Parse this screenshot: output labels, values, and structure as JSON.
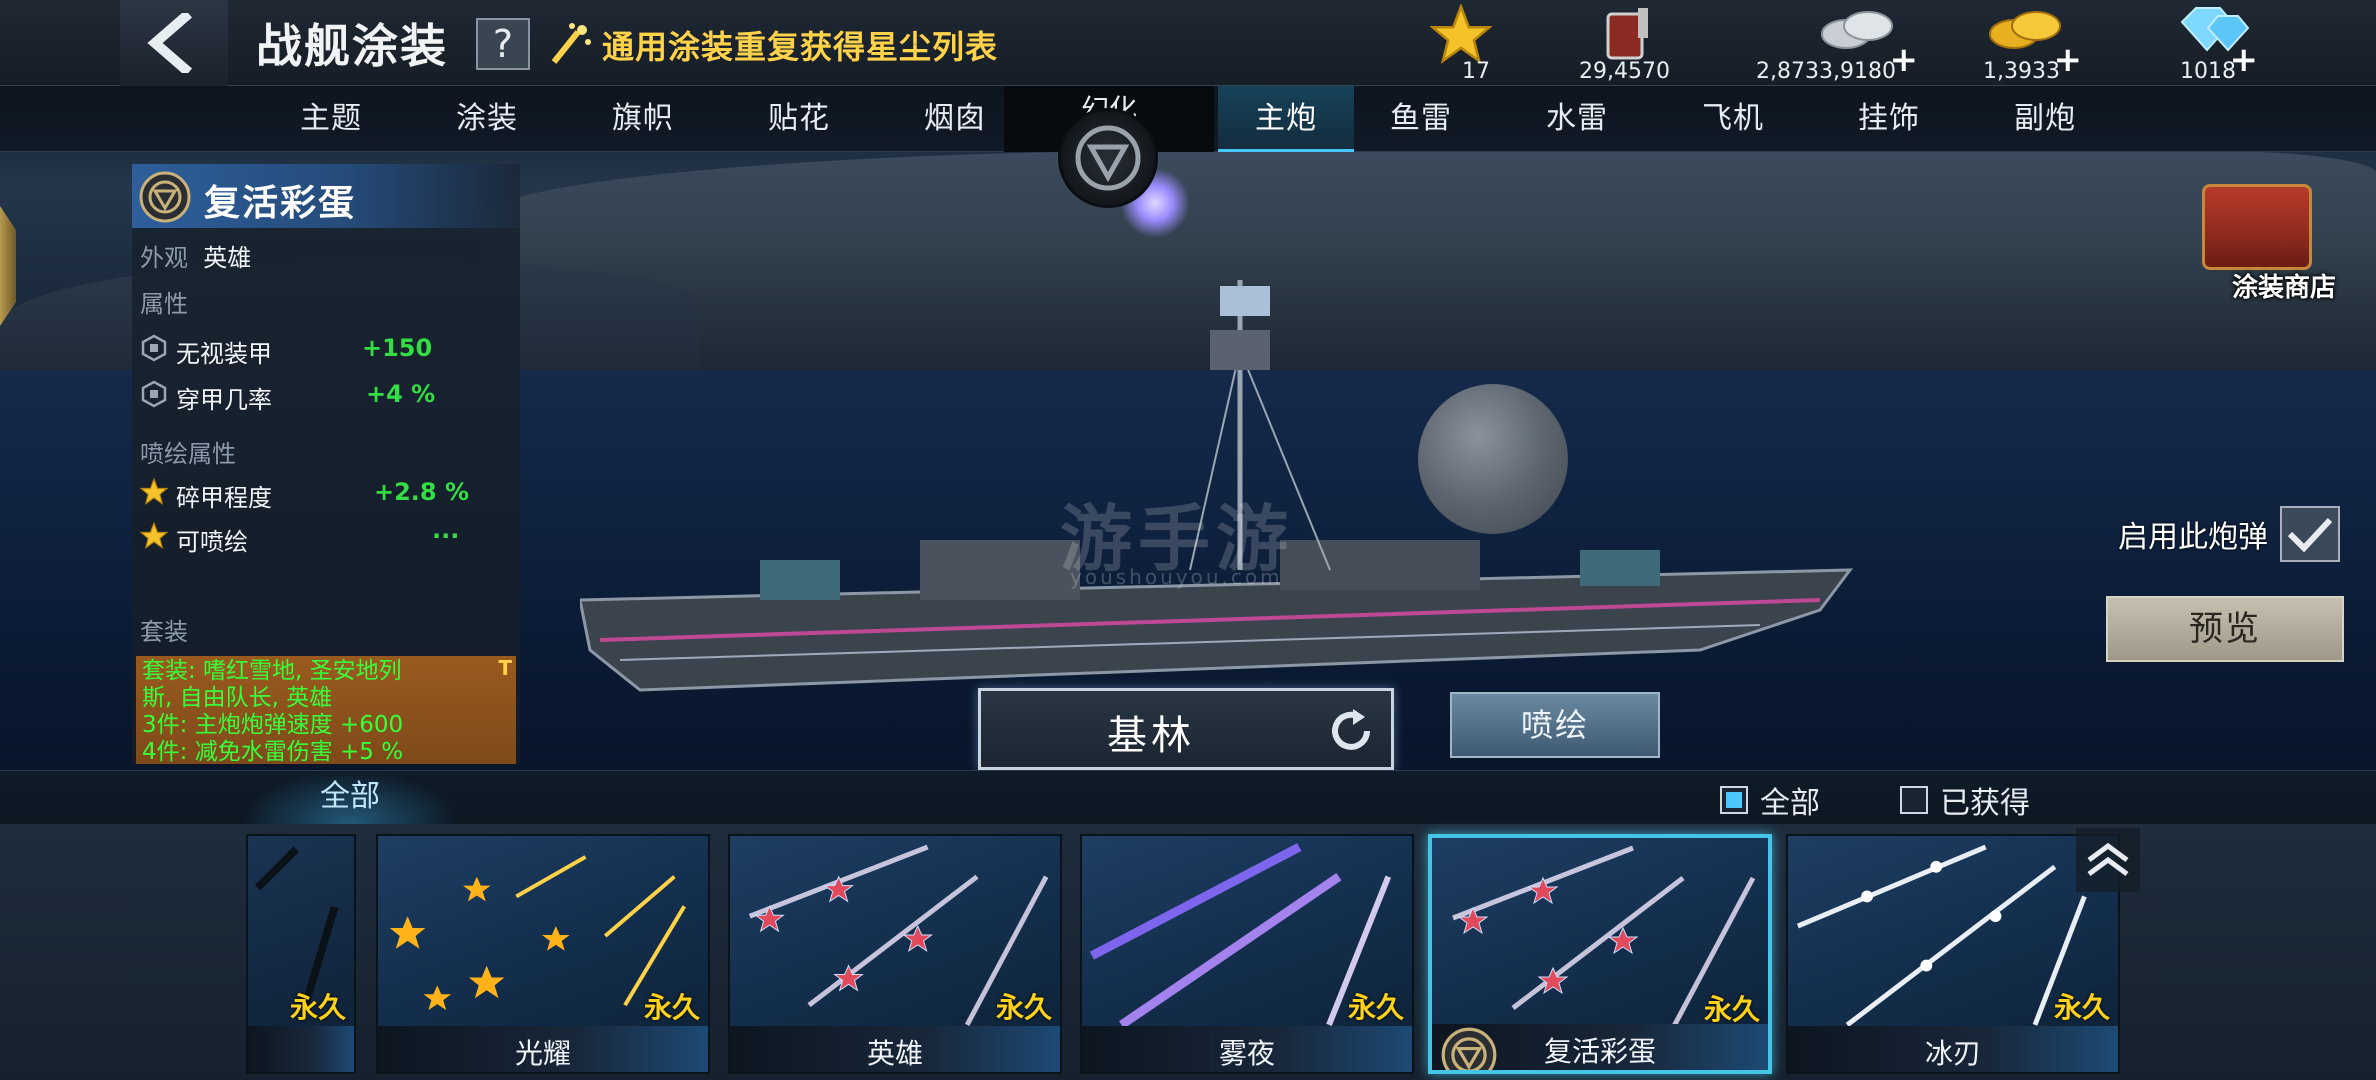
{
  "header": {
    "title": "战舰涂装",
    "help_label": "?",
    "stardust_link": "通用涂装重复获得星尘列表"
  },
  "resources": [
    {
      "icon": "star-icon",
      "value": "17",
      "has_plus": false
    },
    {
      "icon": "paint-bucket-icon",
      "value": "29,4570",
      "has_plus": false
    },
    {
      "icon": "silver-coins-icon",
      "value": "2,8733,9180",
      "has_plus": true
    },
    {
      "icon": "gold-coins-icon",
      "value": "1,3933",
      "has_plus": true
    },
    {
      "icon": "diamond-icon",
      "value": "1018",
      "has_plus": true
    }
  ],
  "plus": "+",
  "tabs": [
    {
      "label": "主题",
      "active": false
    },
    {
      "label": "涂装",
      "active": false
    },
    {
      "label": "旗帜",
      "active": false
    },
    {
      "label": "贴花",
      "active": false
    },
    {
      "label": "烟囱",
      "active": false
    },
    {
      "label": "幻化",
      "active": false
    },
    {
      "label": "主炮",
      "active": true
    },
    {
      "label": "鱼雷",
      "active": false
    },
    {
      "label": "水雷",
      "active": false
    },
    {
      "label": "飞机",
      "active": false
    },
    {
      "label": "挂饰",
      "active": false
    },
    {
      "label": "副炮",
      "active": false
    }
  ],
  "info": {
    "name": "复活彩蛋",
    "appearance_label": "外观",
    "appearance_value": "英雄",
    "attr_header": "属性",
    "attrs": [
      {
        "label": "无视装甲",
        "value": "+150"
      },
      {
        "label": "穿甲几率",
        "value": "+4 %"
      }
    ],
    "spray_header": "喷绘属性",
    "spray_attrs": [
      {
        "label": "碎甲程度",
        "value": "+2.8 %"
      },
      {
        "label": "可喷绘",
        "value": "..."
      }
    ],
    "set_header": "套装",
    "set_lines": [
      "套装: 嗜红雪地, 圣安地列",
      "斯, 自由队长, 英雄",
      "3件: 主炮炮弹速度 +600",
      "4件: 减免水雷伤害 +5 %"
    ],
    "set_mark": "T"
  },
  "watermark": {
    "main": "游手游",
    "sub": "youshouyou.com"
  },
  "right": {
    "shop_label": "涂装商店",
    "enable_label": "启用此炮弹",
    "enable_checked": true,
    "preview_label": "预览"
  },
  "ship_name": "基林",
  "spray_button": "喷绘",
  "filter": {
    "all_tab": "全部",
    "opt_all": "全部",
    "opt_owned": "已获得",
    "all_checked": true,
    "owned_checked": false
  },
  "cards": [
    {
      "name": "",
      "status": "永久",
      "style": "dark"
    },
    {
      "name": "光耀",
      "status": "永久",
      "style": "stars-gold"
    },
    {
      "name": "英雄",
      "status": "永久",
      "style": "stars-red"
    },
    {
      "name": "雾夜",
      "status": "永久",
      "style": "violet"
    },
    {
      "name": "复活彩蛋",
      "status": "永久",
      "style": "stars-red",
      "selected": true
    },
    {
      "name": "冰刃",
      "status": "永久",
      "style": "white"
    }
  ],
  "colors": {
    "accent": "#46c4e8",
    "gold": "#ffd21a",
    "green": "#33dd44",
    "title_yellow": "#ffd24a"
  }
}
